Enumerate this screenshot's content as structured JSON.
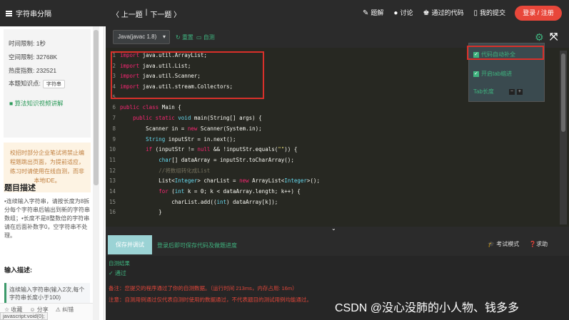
{
  "topbar": {
    "brand": "字符串分隔",
    "prev": "〈 上一题",
    "sep": "|",
    "next": "下一题 〉",
    "actions": [
      {
        "icon": "edit-icon",
        "glyph": "✎",
        "label": "题解"
      },
      {
        "icon": "chat-icon",
        "glyph": "●",
        "label": "讨论"
      },
      {
        "icon": "trophy-icon",
        "glyph": "♚",
        "label": "通过的代码"
      },
      {
        "icon": "doc-icon",
        "glyph": "▯",
        "label": "我的提交"
      }
    ],
    "login": "登录 / 注册"
  },
  "sidebar": {
    "time_limit": "时间限制: 1秒",
    "space_limit": "空间限制: 32768K",
    "heat": "热度指数: 232521",
    "knowledge_label": "本题知识点:",
    "knowledge_tag": "字符串",
    "algo_link": "算法知识视频讲解",
    "notice": "校招时部分企业笔试将禁止编程题跳出页面，为提前适应，练习时请使用在线自测，而非本地IDE。",
    "desc_title": "题目描述",
    "desc": "•连续输入字符串，请按长度为8拆分每个字符串后输出到新的字符串数组；•长度不是8整数倍的字符串请在后面补数字0，空字符串不处理。",
    "input_title": "输入描述:",
    "input_desc": "连续输入字符串(输入2次,每个字符串长度小于100)",
    "bottom_actions": [
      "☆ 收藏",
      "☺ 分享",
      "⚠ 纠错"
    ],
    "status_url": "javascript:void(0);"
  },
  "editor": {
    "language": "Java(javac 1.8)",
    "reset": "重置",
    "custom": "自测",
    "settings_panel": {
      "autocomplete": "代码自动补全",
      "tab_hint": "开启tab缩进",
      "tab_width": "Tab长度"
    },
    "lines": [
      {
        "n": "1",
        "html_tokens": [
          [
            "kw",
            "import"
          ],
          [
            "plain",
            " java.util.ArrayList;"
          ]
        ]
      },
      {
        "n": "2",
        "html_tokens": [
          [
            "kw",
            "import"
          ],
          [
            "plain",
            " java.util.List;"
          ]
        ]
      },
      {
        "n": "3",
        "html_tokens": [
          [
            "kw",
            "import"
          ],
          [
            "plain",
            " java.util.Scanner;"
          ]
        ]
      },
      {
        "n": "4",
        "html_tokens": [
          [
            "kw",
            "import"
          ],
          [
            "plain",
            " java.util.stream.Collectors;"
          ]
        ]
      },
      {
        "n": "5",
        "html_tokens": []
      },
      {
        "n": "6",
        "html_tokens": [
          [
            "kw",
            "public class"
          ],
          [
            "plain",
            " Main {"
          ]
        ]
      },
      {
        "n": "7",
        "html_tokens": [
          [
            "plain",
            "    "
          ],
          [
            "kw",
            "public static"
          ],
          [
            "kw2",
            " void"
          ],
          [
            "plain",
            " main(String[] args) {"
          ]
        ]
      },
      {
        "n": "8",
        "html_tokens": [
          [
            "plain",
            "        Scanner in = "
          ],
          [
            "kw",
            "new"
          ],
          [
            "plain",
            " Scanner(System.in);"
          ]
        ]
      },
      {
        "n": "9",
        "html_tokens": [
          [
            "plain",
            "        "
          ],
          [
            "kw2",
            "String"
          ],
          [
            "plain",
            " inputStr = in.next();"
          ]
        ]
      },
      {
        "n": "10",
        "html_tokens": [
          [
            "plain",
            "        "
          ],
          [
            "kw",
            "if"
          ],
          [
            "plain",
            " (inputStr != "
          ],
          [
            "kw",
            "null"
          ],
          [
            "plain",
            " && !inputStr.equals("
          ],
          [
            "str",
            "\"\""
          ],
          [
            "plain",
            ")) {"
          ]
        ]
      },
      {
        "n": "11",
        "html_tokens": [
          [
            "plain",
            "            "
          ],
          [
            "kw2",
            "char"
          ],
          [
            "plain",
            "[] dataArray = inputStr.toCharArray();"
          ]
        ]
      },
      {
        "n": "12",
        "html_tokens": [
          [
            "plain",
            "            "
          ],
          [
            "cmt",
            "//将数组转化成List"
          ]
        ]
      },
      {
        "n": "13",
        "html_tokens": [
          [
            "plain",
            "            List<"
          ],
          [
            "kw2",
            "Integer"
          ],
          [
            "plain",
            "> charList = "
          ],
          [
            "kw",
            "new"
          ],
          [
            "plain",
            " ArrayList<"
          ],
          [
            "kw2",
            "Integer"
          ],
          [
            "plain",
            ">();"
          ]
        ]
      },
      {
        "n": "14",
        "html_tokens": [
          [
            "plain",
            "            "
          ],
          [
            "kw",
            "for"
          ],
          [
            "plain",
            " ("
          ],
          [
            "kw2",
            "int"
          ],
          [
            "plain",
            " k = 0; k < dataArray.length; k++) {"
          ]
        ]
      },
      {
        "n": "15",
        "html_tokens": [
          [
            "plain",
            "                charList.add(("
          ],
          [
            "kw2",
            "int"
          ],
          [
            "plain",
            ") dataArray[k]);"
          ]
        ]
      },
      {
        "n": "16",
        "html_tokens": [
          [
            "plain",
            "            }"
          ]
        ]
      }
    ]
  },
  "bottom": {
    "run_button": "保存并调试",
    "save_tip": "登录后即可保存代码及做题进度",
    "exam_mode": "考试模式",
    "help": "求助",
    "result_title": "自测结果",
    "result_pass": "✓  通过",
    "result_line1": "备注：您提交的程序通过了你的自测数据。（运行时间 213ms，内存占用: 16m）",
    "result_line2": "注意：自测用例通过仅代表自测时使用的数据通过，不代表题目的测试用例均能通过。"
  },
  "watermark": "CSDN @没心没肺的小人物、钱多多"
}
